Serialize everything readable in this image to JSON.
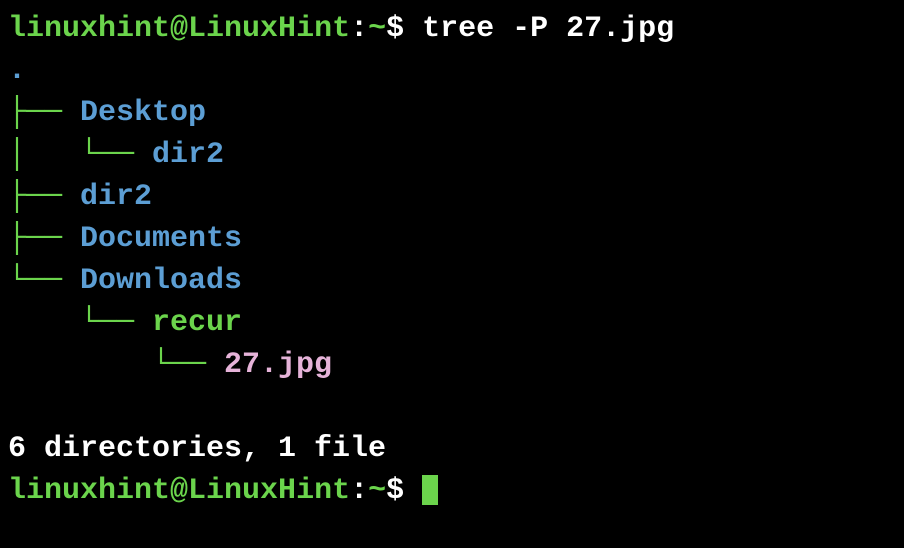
{
  "prompt": {
    "user": "linuxhint",
    "at": "@",
    "host": "LinuxHint",
    "colon": ":",
    "path": "~",
    "dollar": "$ "
  },
  "command": "tree -P 27.jpg",
  "tree": {
    "dot": ".",
    "lines": [
      {
        "prefix": "├── ",
        "name": "Desktop",
        "class": "term-dir"
      },
      {
        "prefix": "│   └── ",
        "name": "dir2",
        "class": "term-dir"
      },
      {
        "prefix": "├── ",
        "name": "dir2",
        "class": "term-dir"
      },
      {
        "prefix": "├── ",
        "name": "Documents",
        "class": "term-dir"
      },
      {
        "prefix": "└── ",
        "name": "Downloads",
        "class": "term-dir"
      },
      {
        "prefix": "    └── ",
        "name": "recur",
        "class": "term-recur"
      },
      {
        "prefix": "        └── ",
        "name": "27.jpg",
        "class": "term-file"
      }
    ]
  },
  "summary": "6 directories, 1 file"
}
